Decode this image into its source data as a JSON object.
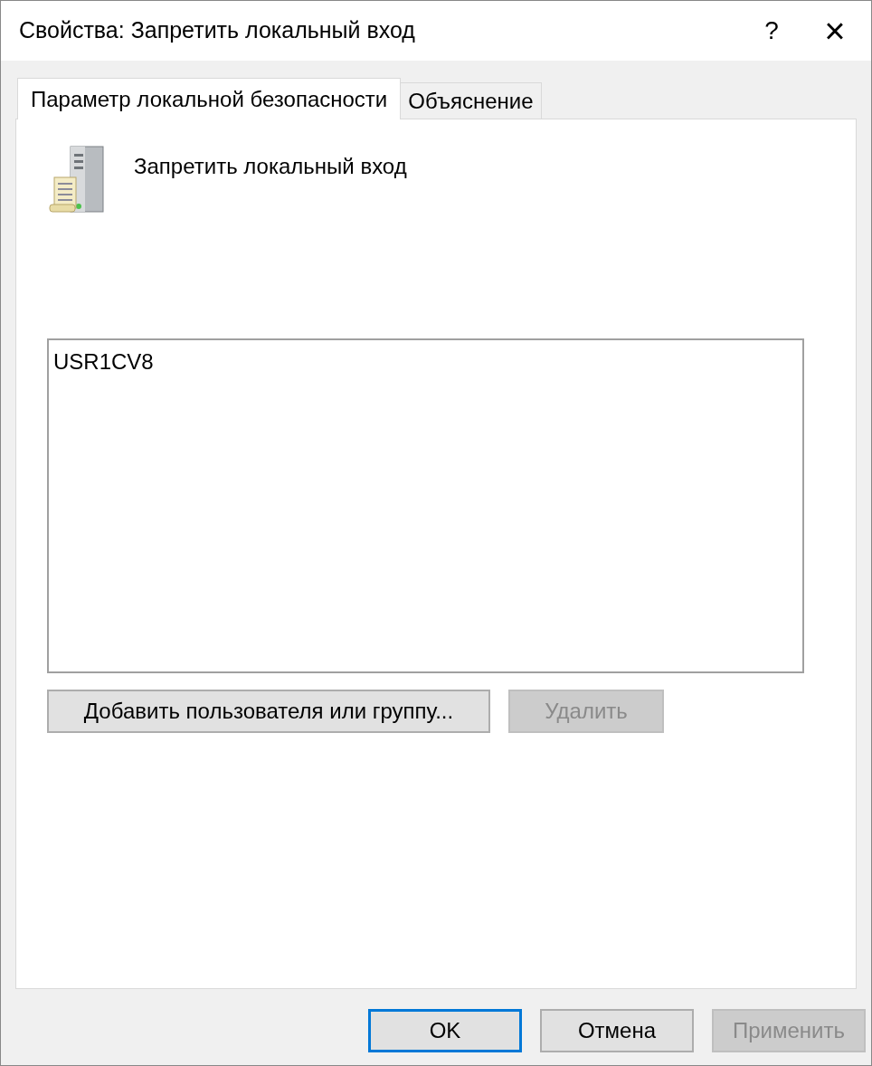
{
  "window": {
    "title": "Свойства: Запретить локальный вход",
    "help": "?",
    "close": "×"
  },
  "tabs": [
    {
      "label": "Параметр локальной безопасности",
      "selected": true
    },
    {
      "label": "Объяснение",
      "selected": false
    }
  ],
  "policy": {
    "name": "Запретить локальный вход"
  },
  "members": [
    {
      "name": "USR1CV8",
      "selected": false
    }
  ],
  "list_buttons": [
    {
      "label": "Добавить пользователя или группу...",
      "disabled": false
    },
    {
      "label": "Удалить",
      "disabled": true
    }
  ],
  "dialog_buttons": [
    {
      "label": "OK",
      "disabled": false,
      "default": true
    },
    {
      "label": "Отмена",
      "disabled": false,
      "default": false
    },
    {
      "label": "Применить",
      "disabled": true,
      "default": false
    }
  ]
}
